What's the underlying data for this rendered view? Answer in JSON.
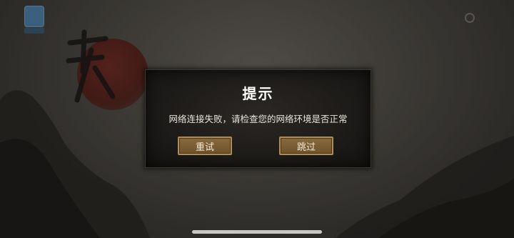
{
  "dialog": {
    "title": "提示",
    "message": "网络连接失败，请检查您的网络环境是否正常",
    "buttons": {
      "retry_label": "重试",
      "skip_label": "跳过"
    }
  },
  "icons": {
    "app_icon": "app-icon",
    "settings": "settings-icon"
  },
  "colors": {
    "dialog_bg": "#1b1917",
    "button_fill": "#7b5d34",
    "button_border": "#b08d52"
  }
}
